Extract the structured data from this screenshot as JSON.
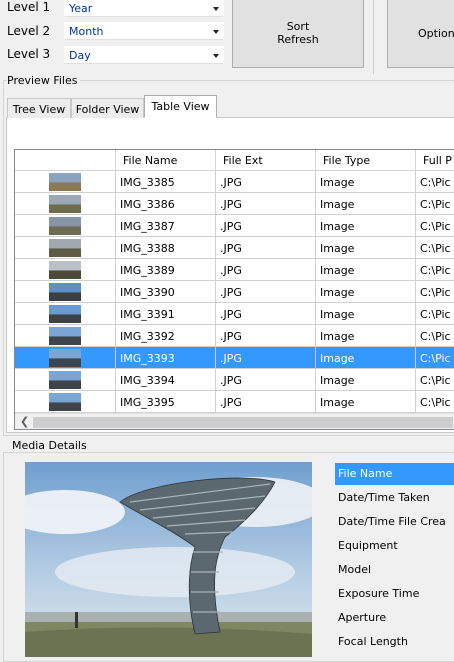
{
  "levels": [
    {
      "label": "Level 1",
      "value": "Year"
    },
    {
      "label": "Level 2",
      "value": "Month"
    },
    {
      "label": "Level 3",
      "value": "Day"
    }
  ],
  "buttons": {
    "sort_refresh_line1": "Sort",
    "sort_refresh_line2": "Refresh",
    "options": "Option"
  },
  "preview": {
    "group_label": "Preview Files",
    "tabs": [
      "Tree View",
      "Folder View",
      "Table View"
    ],
    "active_tab": "Table View",
    "columns": [
      "",
      "File Name",
      "File Ext",
      "File Type",
      "Full P"
    ],
    "rows": [
      {
        "name": "IMG_3385",
        "ext": ".JPG",
        "type": "Image",
        "path": "C:\\Pic",
        "selected": false
      },
      {
        "name": "IMG_3386",
        "ext": ".JPG",
        "type": "Image",
        "path": "C:\\Pic",
        "selected": false
      },
      {
        "name": "IMG_3387",
        "ext": ".JPG",
        "type": "Image",
        "path": "C:\\Pic",
        "selected": false
      },
      {
        "name": "IMG_3388",
        "ext": ".JPG",
        "type": "Image",
        "path": "C:\\Pic",
        "selected": false
      },
      {
        "name": "IMG_3389",
        "ext": ".JPG",
        "type": "Image",
        "path": "C:\\Pic",
        "selected": false
      },
      {
        "name": "IMG_3390",
        "ext": ".JPG",
        "type": "Image",
        "path": "C:\\Pic",
        "selected": false
      },
      {
        "name": "IMG_3391",
        "ext": ".JPG",
        "type": "Image",
        "path": "C:\\Pic",
        "selected": false
      },
      {
        "name": "IMG_3392",
        "ext": ".JPG",
        "type": "Image",
        "path": "C:\\Pic",
        "selected": false
      },
      {
        "name": "IMG_3393",
        "ext": ".JPG",
        "type": "Image",
        "path": "C:\\Pic",
        "selected": true
      },
      {
        "name": "IMG_3394",
        "ext": ".JPG",
        "type": "Image",
        "path": "C:\\Pic",
        "selected": false
      },
      {
        "name": "IMG_3395",
        "ext": ".JPG",
        "type": "Image",
        "path": "C:\\Pic",
        "selected": false
      }
    ],
    "scroll_left_icon": "chevron-left-icon"
  },
  "media": {
    "group_label": "Media Details",
    "properties": [
      "File Name",
      "Date/Time Taken",
      "Date/Time File Crea",
      "Equipment",
      "Model",
      "Exposure Time",
      "Aperture",
      "Focal Length"
    ],
    "selected_property": "File Name"
  },
  "colors": {
    "selection": "#3399ff",
    "combo_text": "#003399"
  }
}
